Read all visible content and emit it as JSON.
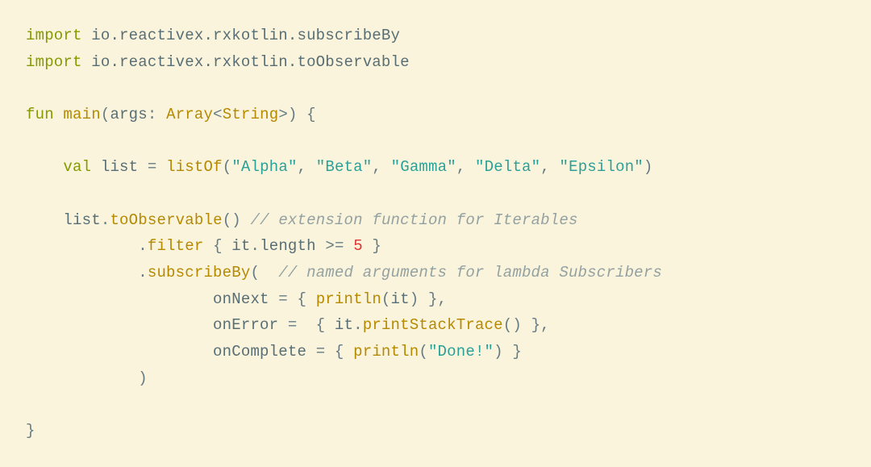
{
  "tokens": {
    "kw_import": "import",
    "pkg_subscribeBy": "io.reactivex.rxkotlin.subscribeBy",
    "pkg_toObservable": "io.reactivex.rxkotlin.toObservable",
    "kw_fun": "fun",
    "fn_main": "main",
    "id_args": "args",
    "type_Array": "Array",
    "type_String": "String",
    "kw_val": "val",
    "id_list": "list",
    "fn_listOf": "listOf",
    "str_alpha": "\"Alpha\"",
    "str_beta": "\"Beta\"",
    "str_gamma": "\"Gamma\"",
    "str_delta": "\"Delta\"",
    "str_epsilon": "\"Epsilon\"",
    "fn_toObservable": "toObservable",
    "cm_ext": "// extension function for Iterables",
    "fn_filter": "filter",
    "id_it": "it",
    "id_length": "length",
    "num_5": "5",
    "fn_subscribeBy": "subscribeBy",
    "cm_named": "// named arguments for lambda Subscribers",
    "id_onNext": "onNext",
    "fn_println": "println",
    "id_onError": "onError",
    "fn_printStackTrace": "printStackTrace",
    "id_onComplete": "onComplete",
    "str_done": "\"Done!\"",
    "op_ge": ">="
  }
}
